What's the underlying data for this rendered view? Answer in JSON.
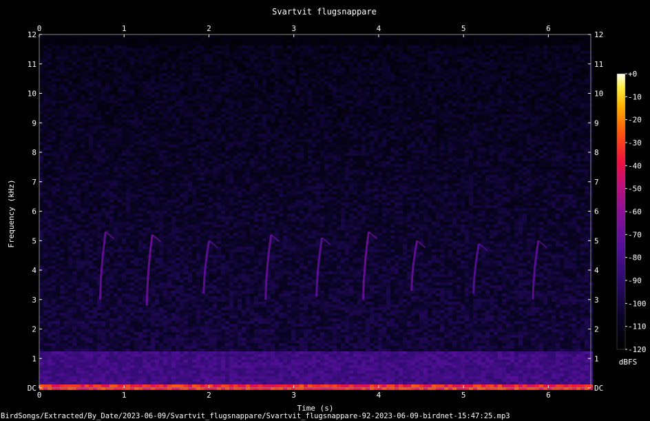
{
  "chart_data": {
    "type": "heatmap",
    "title": "Svartvit flugsnappare",
    "xlabel": "Time (s)",
    "ylabel": "Frequency (kHz)",
    "xlim": [
      0,
      6.5
    ],
    "ylim": [
      0,
      12
    ],
    "x_ticks": [
      "0",
      "1",
      "2",
      "3",
      "4",
      "5",
      "6"
    ],
    "y_ticks": [
      "DC",
      "1",
      "2",
      "3",
      "4",
      "5",
      "6",
      "7",
      "8",
      "9",
      "10",
      "11",
      "12"
    ],
    "colorbar": {
      "label": "dBFS",
      "ticks": [
        "+0",
        "-10",
        "-20",
        "-30",
        "-40",
        "-50",
        "-60",
        "-70",
        "-80",
        "-90",
        "-100",
        "-110",
        "-120"
      ],
      "range": [
        -120,
        0
      ]
    },
    "calls": [
      {
        "t": 0.75,
        "f_low": 3.0,
        "f_high": 5.3,
        "level": -70
      },
      {
        "t": 1.3,
        "f_low": 2.8,
        "f_high": 5.2,
        "level": -68
      },
      {
        "t": 1.97,
        "f_low": 3.2,
        "f_high": 5.0,
        "level": -72
      },
      {
        "t": 2.7,
        "f_low": 3.0,
        "f_high": 5.2,
        "level": -70
      },
      {
        "t": 3.3,
        "f_low": 3.1,
        "f_high": 5.1,
        "level": -72
      },
      {
        "t": 3.85,
        "f_low": 3.0,
        "f_high": 5.3,
        "level": -68
      },
      {
        "t": 4.42,
        "f_low": 3.3,
        "f_high": 5.0,
        "level": -70
      },
      {
        "t": 5.15,
        "f_low": 3.2,
        "f_high": 4.9,
        "level": -74
      },
      {
        "t": 5.85,
        "f_low": 3.0,
        "f_high": 5.0,
        "level": -72
      }
    ],
    "background_level": -100,
    "low_band": {
      "f_low": 0,
      "f_high": 1.2,
      "level": -82
    }
  },
  "footer": {
    "filename": "BirdSongs/Extracted/By_Date/2023-06-09/Svartvit_flugsnappare/Svartvit_flugsnappare-92-2023-06-09-birdnet-15:47:25.mp3"
  }
}
